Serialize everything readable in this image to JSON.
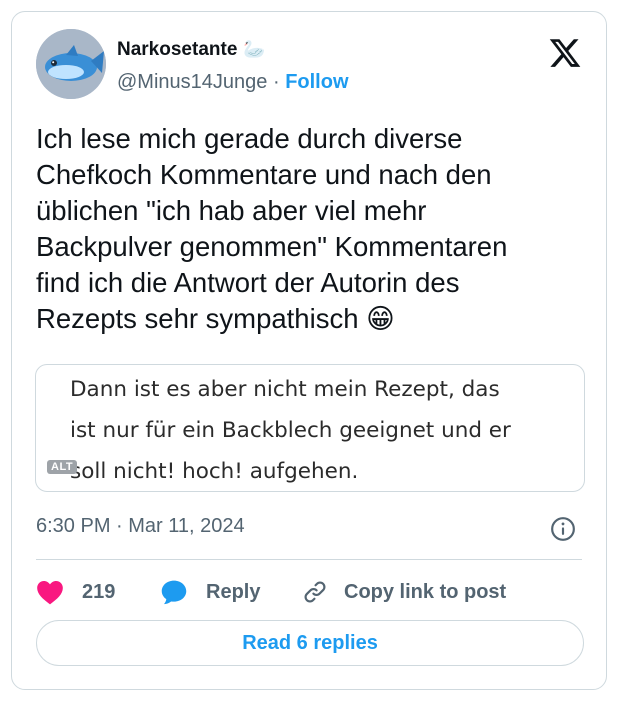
{
  "author": {
    "name": "Narkosetante",
    "name_emoji": "🦢",
    "handle": "@Minus14Junge",
    "separator": "·",
    "follow_label": "Follow",
    "avatar_icon": "blue-fish-icon"
  },
  "brand": {
    "logo_icon": "x-logo-icon"
  },
  "post": {
    "text": "Ich lese mich gerade durch diverse\nChefkoch Kommentare und nach den\nüblichen \"ich hab aber viel mehr\nBackpulver genommen\" Kommentaren\nfind ich die Antwort der Autorin des\nRezepts sehr sympathisch",
    "trailing_emoji": "😁"
  },
  "media": {
    "text": "Dann ist es aber nicht mein Rezept, das\nist nur für ein Backblech geeignet und er\nsoll nicht! hoch! aufgehen.",
    "alt_label": "ALT"
  },
  "meta": {
    "timestamp": "6:30 PM · Mar 11, 2024",
    "info_icon": "info-icon"
  },
  "actions": {
    "like_count": "219",
    "reply_label": "Reply",
    "copy_label": "Copy link to post"
  },
  "footer": {
    "read_replies_label": "Read 6 replies"
  },
  "colors": {
    "accent": "#1d9bf0",
    "like": "#f91880",
    "text": "#0f1419",
    "muted": "#536471",
    "border": "#cfd9de"
  }
}
